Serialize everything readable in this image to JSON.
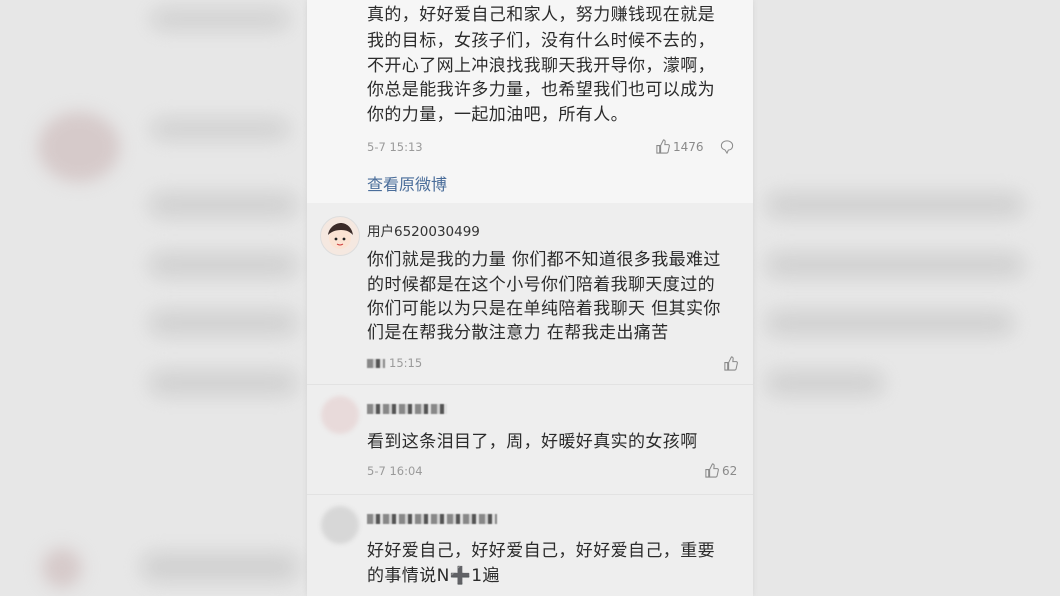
{
  "post": {
    "lines": [
      "真的，好好爱自己和家人，努力赚钱现在就是",
      "我的目标，女孩子们，没有什么时候不去的，",
      "不开心了网上冲浪找我聊天我开导你，濛啊，",
      "你总是能我许多力量，也希望我们也可以成为",
      "你的力量，一起加油吧，所有人。"
    ],
    "time": "5-7 15:13",
    "likes": "1476",
    "view_original": "查看原微博"
  },
  "comments": [
    {
      "username": "用户6520030499",
      "lines": [
        "你们就是我的力量 你们都不知道很多我最难过",
        "的时候都是在这个小号你们陪着我聊天度过的",
        "你们可能以为只是在单纯陪着我聊天 但其实你",
        "们是在帮我分散注意力 在帮我走出痛苦"
      ],
      "time": "15:15",
      "likes": ""
    },
    {
      "username": "",
      "lines": [
        "看到这条泪目了，周，好暖好真实的女孩啊"
      ],
      "time": "5-7 16:04",
      "likes": "62"
    },
    {
      "username": "",
      "lines": [
        "好好爱自己，好好爱自己，好好爱自己，重要",
        "的事情说N➕1遍"
      ],
      "time": "",
      "likes": ""
    }
  ],
  "icons": {
    "like": "thumbs-up-icon",
    "comment": "comment-bubble-icon"
  },
  "colors": {
    "link": "#4a6d9a",
    "text": "#2b2b2b",
    "meta": "#9a9a9a"
  }
}
